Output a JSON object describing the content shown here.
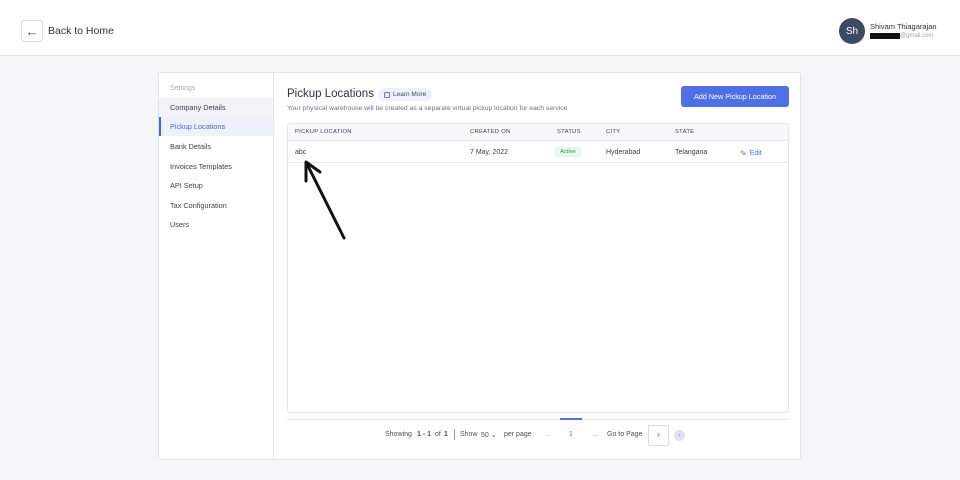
{
  "header": {
    "back_label": "Back to Home",
    "user_initials": "Sh",
    "user_name": "Shivam Thiagarajan",
    "user_email_suffix": "@gmail.com"
  },
  "sidebar": {
    "heading": "Settings",
    "items": [
      {
        "label": "Company Details"
      },
      {
        "label": "Pickup Locations"
      },
      {
        "label": "Bank Details"
      },
      {
        "label": "Invoices Templates"
      },
      {
        "label": "API Setup"
      },
      {
        "label": "Tax Configuration"
      },
      {
        "label": "Users"
      }
    ],
    "active_index": 1
  },
  "page": {
    "title": "Pickup Locations",
    "learn_more": "Learn More",
    "subtitle": "Your physical warehouse will be created as a separate virtual pickup location for each service",
    "add_button": "Add New Pickup Location"
  },
  "table": {
    "columns": [
      "PICKUP LOCATION",
      "CREATED ON",
      "STATUS",
      "CITY",
      "STATE"
    ],
    "rows": [
      {
        "location": "abc",
        "created_on": "7 May, 2022",
        "status": "Active",
        "city": "Hyderabad",
        "state": "Telangana",
        "action": "Edit"
      }
    ]
  },
  "pagination": {
    "showing_prefix": "Showing",
    "range": "1 - 1",
    "of_label": "of",
    "total": "1",
    "show_label": "Show",
    "page_size": "50",
    "per_page_label": "per page",
    "current_page": "1",
    "goto_label": "Go to Page",
    "goto_placeholder": "x"
  },
  "colors": {
    "accent": "#4f6fe6",
    "active_status": "#23985a",
    "avatar_bg": "#3d4a66"
  }
}
